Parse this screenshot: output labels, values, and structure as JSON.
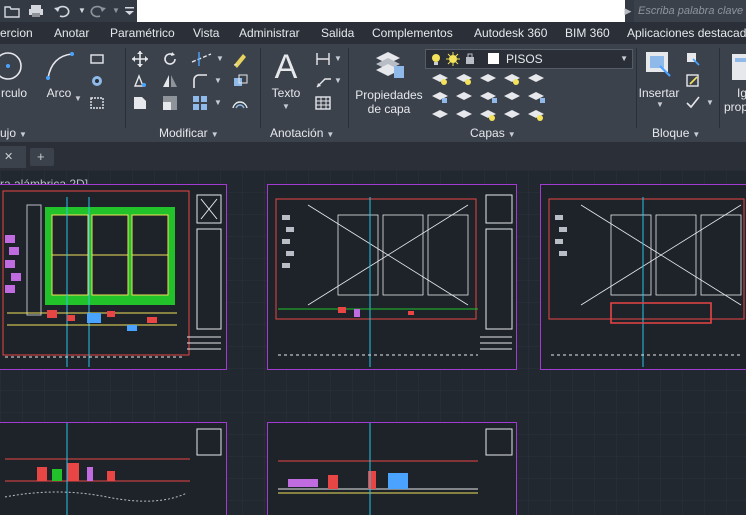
{
  "search": {
    "placeholder": "Escriba palabra clave o"
  },
  "menu_tabs": [
    {
      "label": "ercion"
    },
    {
      "label": "Anotar"
    },
    {
      "label": "Paramétrico"
    },
    {
      "label": "Vista"
    },
    {
      "label": "Administrar"
    },
    {
      "label": "Salida"
    },
    {
      "label": "Complementos"
    },
    {
      "label": "Autodesk 360"
    },
    {
      "label": "BIM 360"
    },
    {
      "label": "Aplicaciones destacadas"
    }
  ],
  "ribbon": {
    "draw": {
      "circle_label": "rculo",
      "arc_label": "Arco",
      "panel_title": "ujo"
    },
    "modify": {
      "panel_title": "Modificar"
    },
    "annotation": {
      "text_label": "Texto",
      "panel_title": "Anotación"
    },
    "layers": {
      "properties_label_1": "Propiedades",
      "properties_label_2": "de capa",
      "current_layer": "PISOS",
      "panel_title": "Capas"
    },
    "block": {
      "insert_label": "Insertar",
      "panel_title": "Bloque",
      "cut1": "Ig",
      "cut2": "prop"
    }
  },
  "viewport": {
    "label": "ra alámbrica 2D]"
  },
  "colors": {
    "ribbon_bg": "#3c424c",
    "canvas_bg": "#212830",
    "sheet_border": "#a23bd1",
    "grass": "#21c22a"
  },
  "icons": [
    "undo-icon",
    "redo-icon",
    "print-icon",
    "layer-properties-icon",
    "insert-block-icon",
    "text-icon",
    "table-icon"
  ]
}
